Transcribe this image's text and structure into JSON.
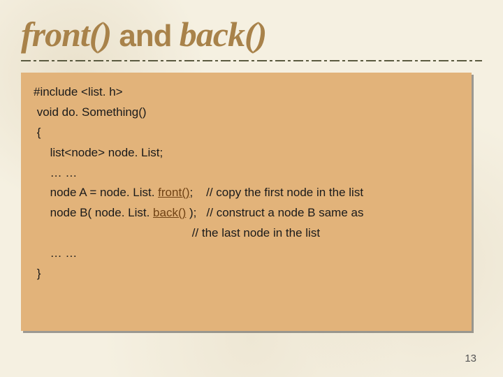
{
  "title": {
    "part1": "front()",
    "joiner": " and ",
    "part2": "back()"
  },
  "code": {
    "l01": "#include <list. h>",
    "l02": " void do. Something()",
    "l03": " {",
    "l04": "     list<node> node. List;",
    "l05": "     … …",
    "l06a": "     node A = node. List. ",
    "l06b": "front()",
    "l06c": ";",
    "l06d": "    // copy the first node in the list",
    "l07a": "     node B( node. List. ",
    "l07b": "back()",
    "l07c": " );",
    "l07d": "   // construct a node B same as",
    "l08": "                                                // the last node in the list",
    "l09": "     … …",
    "l10": " }"
  },
  "page_number": "13"
}
